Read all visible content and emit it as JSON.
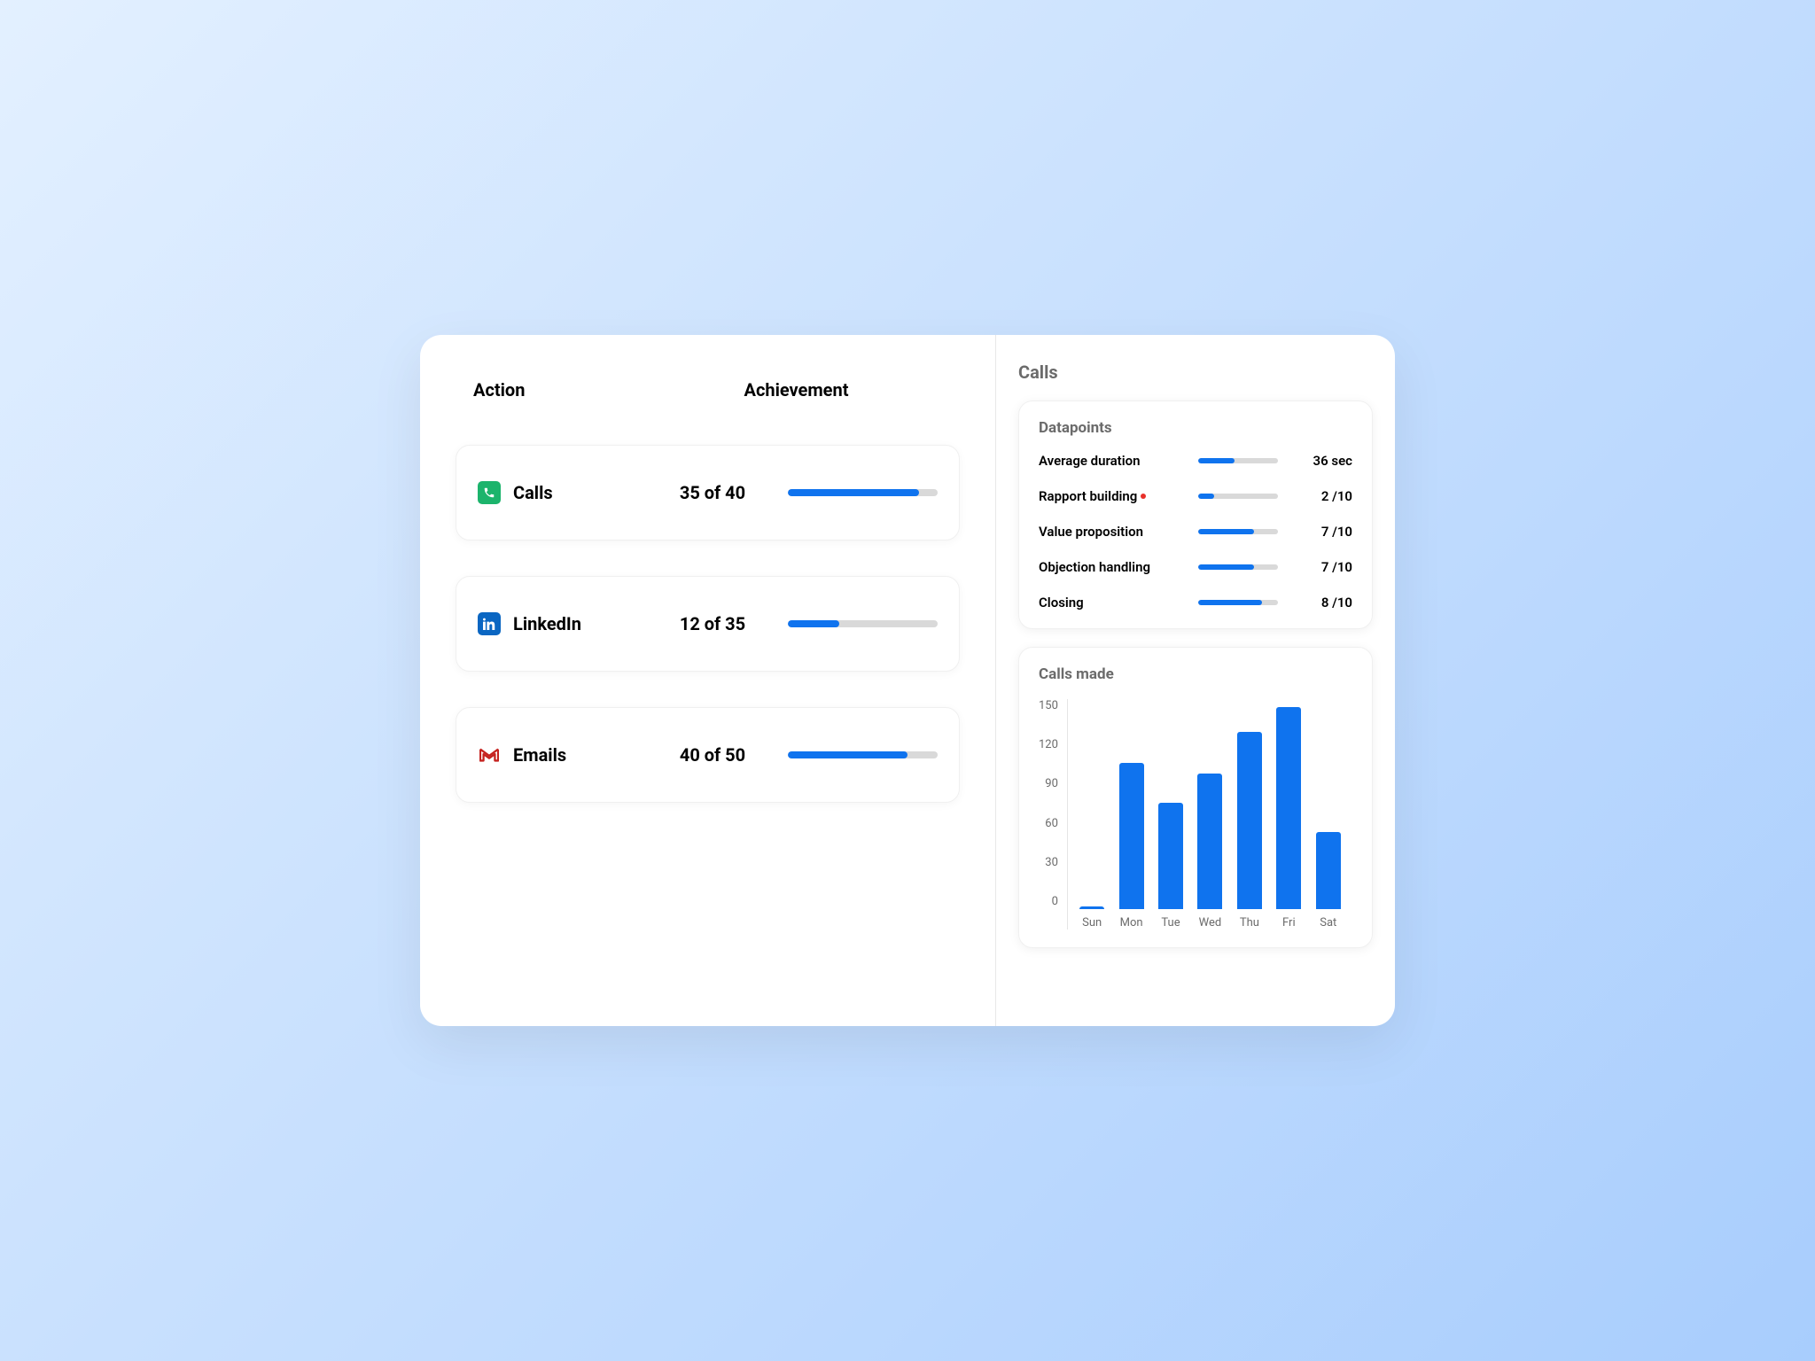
{
  "left": {
    "header_action": "Action",
    "header_achievement": "Achievement",
    "actions": [
      {
        "icon": "calls",
        "label": "Calls",
        "achievement": "35 of 40",
        "progress_pct": 87.5
      },
      {
        "icon": "linkedin",
        "label": "LinkedIn",
        "achievement": "12 of 35",
        "progress_pct": 34.3
      },
      {
        "icon": "emails",
        "label": "Emails",
        "achievement": "40 of 50",
        "progress_pct": 80
      }
    ]
  },
  "right": {
    "title": "Calls",
    "datapoints": {
      "title": "Datapoints",
      "items": [
        {
          "label": "Average duration",
          "flag": false,
          "progress_pct": 45,
          "value": "36 sec"
        },
        {
          "label": "Rapport building",
          "flag": true,
          "progress_pct": 20,
          "value": "2 /10"
        },
        {
          "label": "Value proposition",
          "flag": false,
          "progress_pct": 70,
          "value": "7 /10"
        },
        {
          "label": "Objection handling",
          "flag": false,
          "progress_pct": 70,
          "value": "7 /10"
        },
        {
          "label": "Closing",
          "flag": false,
          "progress_pct": 80,
          "value": "8 /10"
        }
      ]
    },
    "chart": {
      "title": "Calls made"
    }
  },
  "chart_data": {
    "type": "bar",
    "title": "Calls made",
    "categories": [
      "Sun",
      "Mon",
      "Tue",
      "Wed",
      "Thu",
      "Fri",
      "Sat"
    ],
    "values": [
      2,
      105,
      76,
      97,
      127,
      145,
      55
    ],
    "ylabel": "",
    "xlabel": "",
    "ylim": [
      0,
      150
    ],
    "yticks": [
      0,
      30,
      60,
      90,
      120,
      150
    ]
  }
}
